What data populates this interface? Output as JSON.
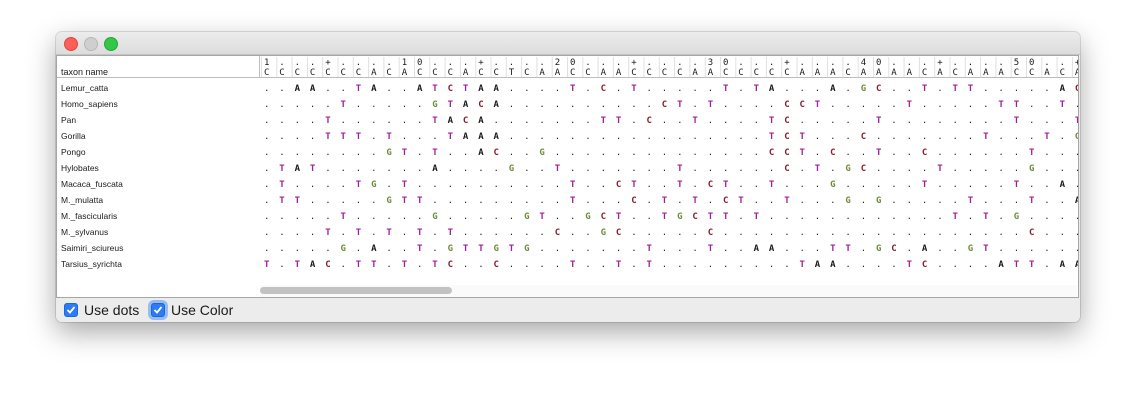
{
  "window": {
    "title": "",
    "controls": {
      "close": "close-icon",
      "minimize": "minimize-icon",
      "maximize": "maximize-icon"
    }
  },
  "table": {
    "header_label": "taxon name",
    "ruler": [
      "1",
      ".",
      ".",
      ".",
      "+",
      ".",
      ".",
      ".",
      ".",
      "1",
      "0",
      ".",
      ".",
      ".",
      "+",
      ".",
      ".",
      ".",
      ".",
      "2",
      "0",
      ".",
      ".",
      ".",
      "+",
      ".",
      ".",
      ".",
      ".",
      "3",
      "0",
      ".",
      ".",
      ".",
      "+",
      ".",
      ".",
      ".",
      ".",
      "4",
      "0",
      ".",
      ".",
      ".",
      "+",
      ".",
      ".",
      ".",
      ".",
      "5",
      "0",
      ".",
      ".",
      "+"
    ],
    "consensus": [
      "C",
      "C",
      "C",
      "C",
      "C",
      "C",
      "C",
      "A",
      "C",
      "A",
      "C",
      "C",
      "C",
      "A",
      "C",
      "C",
      "T",
      "C",
      "A",
      "A",
      "C",
      "C",
      "A",
      "A",
      "C",
      "C",
      "C",
      "C",
      "A",
      "A",
      "C",
      "C",
      "C",
      "C",
      "C",
      "A",
      "A",
      "A",
      "C",
      "A",
      "A",
      "A",
      "A",
      "C",
      "A",
      "C",
      "A",
      "A",
      "A",
      "C",
      "C",
      "A",
      "C",
      "A",
      "C"
    ],
    "taxa": [
      {
        "name": "Lemur_catta",
        "seq": "..AA..TA..ATCTAA....T.C.T.....T.TA...A.GC..T.TT.....ACC"
      },
      {
        "name": "Homo_sapiens",
        "seq": ".....T.....GTACA..........CT.T....CCT.....T.....TT..T.."
      },
      {
        "name": "Pan",
        "seq": "....T......TACA.......TT.C..T....TC.....T........T...T."
      },
      {
        "name": "Gorilla",
        "seq": "....TTT.T...TAAA.................TCT...C.......T...T.G."
      },
      {
        "name": "Pongo",
        "seq": "........GT.T..AC..G..............CCT.C..T..C......T..."
      },
      {
        "name": "Hylobates",
        "seq": ".TAT.......A....G..T.......T......C.T.GC....T.....G....."
      },
      {
        "name": "Macaca_fuscata",
        "seq": ".T....TG.T..........T..CT..T.CT..T...G.....T.....T..A."
      },
      {
        "name": "M._mulatta",
        "seq": ".TT.....GTT.........T...C.T.T.CT..T...G.G.....T...T..A."
      },
      {
        "name": "M._fascicularis",
        "seq": ".....T.....G.....GT..GCT..TGCTT.T............T.T.G...."
      },
      {
        "name": "M._sylvanus",
        "seq": "....T.T.T.T.T......C..GC.....C....................C....."
      },
      {
        "name": "Saimiri_sciureus",
        "seq": ".....G.A..T.GTTGTG.......T...T..AA...TT.GC.A..GT......"
      },
      {
        "name": "Tarsius_syrichta",
        "seq": "T.TAC.TT.T.TC..C....T..T.T.........TAA....TC....ATT.AA...CC"
      }
    ]
  },
  "footer": {
    "use_dots_label": "Use dots",
    "use_dots_checked": true,
    "use_color_label": "Use Color",
    "use_color_checked": true
  },
  "colors": {
    "A": "#1a1a1a",
    "C": "#8a1a2a",
    "G": "#6f8a3c",
    "T": "#a0209a",
    "dot": "#222222",
    "checkbox": "#2c7cf6"
  }
}
